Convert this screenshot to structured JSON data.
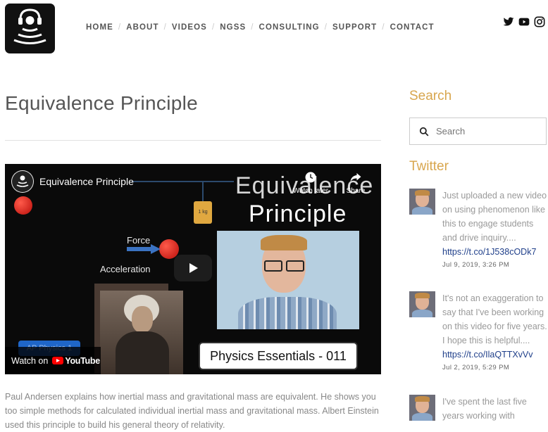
{
  "nav": {
    "items": [
      "HOME",
      "ABOUT",
      "VIDEOS",
      "NGSS",
      "CONSULTING",
      "SUPPORT",
      "CONTACT"
    ]
  },
  "social": [
    "twitter-icon",
    "youtube-icon",
    "instagram-icon"
  ],
  "post": {
    "title": "Equivalence Principle",
    "description": "Paul Andersen explains how inertial mass and gravitational mass are equivalent.  He shows you too simple methods for calculated individual inertial mass and gravitational mass.  Albert Einstein used this principle to build his general theory of relativity."
  },
  "video": {
    "title": "Equivalence Principle",
    "watch_later": "Watch later",
    "share": "Share",
    "watch_on": "Watch on",
    "youtube": "YouTube",
    "slide_title_1": "Equivalence",
    "slide_title_2": "Principle",
    "label_force": "Force",
    "label_acceleration": "Acceleration",
    "label_1kg": "1 kg",
    "caption": "Physics Essentials - 011",
    "faded_button": "AP Physics 1"
  },
  "sidebar": {
    "search_heading": "Search",
    "search_placeholder": "Search",
    "twitter_heading": "Twitter",
    "tweets": [
      {
        "text": "Just uploaded a new video on using phenomenon like this to engage students and drive inquiry....",
        "link": "https://t.co/1J538cODk7",
        "date": "Jul 9, 2019, 3:26 PM"
      },
      {
        "text": "It's not an exaggeration to say that I've been working on this video for five years. I hope this is helpful....",
        "link": "https://t.co/IlaQTTXvVv",
        "date": "Jul 2, 2019, 5:29 PM"
      },
      {
        "text": "I've spent the last five years working with",
        "link": "",
        "date": ""
      }
    ]
  },
  "colors": {
    "accent": "#d8a64e",
    "link": "#1f3f8a",
    "youtube_red": "#ff0000"
  }
}
